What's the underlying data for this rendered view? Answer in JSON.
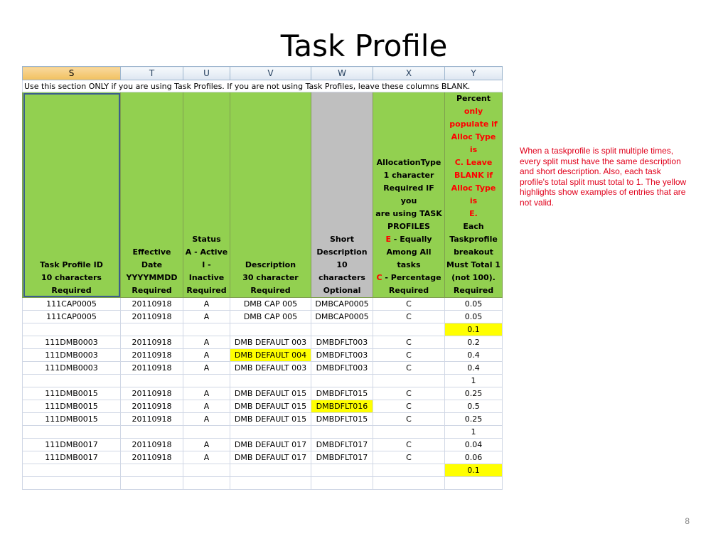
{
  "slide": {
    "title": "Task Profile",
    "page_number": "8",
    "note": "When a taskprofile is split multiple times, every split must have the same description and short description.  Also, each task profile's total split must total to 1.  The yellow highlights show examples of entries that are not valid."
  },
  "sheet": {
    "columns": [
      "S",
      "T",
      "U",
      "V",
      "W",
      "X",
      "Y"
    ],
    "notice": "Use this section ONLY if you are using Task Profiles.  If you are not using Task Profiles, leave these columns BLANK.",
    "headers": {
      "task_profile": [
        "Task Profile ID",
        "10 characters",
        "Required"
      ],
      "effective_date": [
        "Effective Date",
        "YYYYMMDD",
        "Required"
      ],
      "status": [
        "Status",
        "A - Active",
        "I - Inactive",
        "Required"
      ],
      "description": [
        "Description",
        "30 character",
        "Required"
      ],
      "short_description": [
        "Short",
        "Description",
        "10 characters",
        "Optional"
      ],
      "allocation": {
        "lines": [
          "AllocationType",
          "1 character",
          "Required IF you",
          "are using TASK",
          "PROFILES"
        ],
        "e_code": "E",
        "e_text": " - Equally",
        "e_text2": "Among All tasks",
        "c_code": "C",
        "c_text": " - Percentage",
        "required": "Required"
      },
      "percent": {
        "p1": "Percent ",
        "p1_red": "only",
        "red_lines": [
          "populate if",
          "Alloc Type is",
          "C.  Leave",
          "BLANK if",
          "Alloc Type is",
          "E."
        ],
        "black_lines": [
          "Each",
          "Taskprofile",
          "breakout",
          "Must Total 1",
          "(not 100).",
          "Required"
        ]
      }
    },
    "rows": [
      {
        "id": "111CAP0005",
        "date": "20110918",
        "status": "A",
        "desc": "DMB CAP 005",
        "short": "DMBCAP0005",
        "alloc": "C",
        "pct": "0.05"
      },
      {
        "id": "111CAP0005",
        "date": "20110918",
        "status": "A",
        "desc": "DMB CAP 005",
        "short": "DMBCAP0005",
        "alloc": "C",
        "pct": "0.05"
      },
      {
        "id": "",
        "date": "",
        "status": "",
        "desc": "",
        "short": "",
        "alloc": "",
        "pct": "0.1",
        "pct_hl": true
      },
      {
        "id": "111DMB0003",
        "date": "20110918",
        "status": "A",
        "desc": "DMB DEFAULT 003",
        "short": "DMBDFLT003",
        "alloc": "C",
        "pct": "0.2"
      },
      {
        "id": "111DMB0003",
        "date": "20110918",
        "status": "A",
        "desc": "DMB DEFAULT 004",
        "desc_hl": true,
        "short": "DMBDFLT003",
        "alloc": "C",
        "pct": "0.4"
      },
      {
        "id": "111DMB0003",
        "date": "20110918",
        "status": "A",
        "desc": "DMB DEFAULT 003",
        "short": "DMBDFLT003",
        "alloc": "C",
        "pct": "0.4"
      },
      {
        "id": "",
        "date": "",
        "status": "",
        "desc": "",
        "short": "",
        "alloc": "",
        "pct": "1"
      },
      {
        "id": "111DMB0015",
        "date": "20110918",
        "status": "A",
        "desc": "DMB DEFAULT 015",
        "short": "DMBDFLT015",
        "alloc": "C",
        "pct": "0.25"
      },
      {
        "id": "111DMB0015",
        "date": "20110918",
        "status": "A",
        "desc": "DMB DEFAULT 015",
        "short": "DMBDFLT016",
        "short_hl": true,
        "alloc": "C",
        "pct": "0.5"
      },
      {
        "id": "111DMB0015",
        "date": "20110918",
        "status": "A",
        "desc": "DMB DEFAULT 015",
        "short": "DMBDFLT015",
        "alloc": "C",
        "pct": "0.25"
      },
      {
        "id": "",
        "date": "",
        "status": "",
        "desc": "",
        "short": "",
        "alloc": "",
        "pct": "1"
      },
      {
        "id": "111DMB0017",
        "date": "20110918",
        "status": "A",
        "desc": "DMB DEFAULT 017",
        "short": "DMBDFLT017",
        "alloc": "C",
        "pct": "0.04"
      },
      {
        "id": "111DMB0017",
        "date": "20110918",
        "status": "A",
        "desc": "DMB DEFAULT 017",
        "short": "DMBDFLT017",
        "alloc": "C",
        "pct": "0.06"
      },
      {
        "id": "",
        "date": "",
        "status": "",
        "desc": "",
        "short": "",
        "alloc": "",
        "pct": "0.1",
        "pct_hl": true
      },
      {
        "id": "",
        "date": "",
        "status": "",
        "desc": "",
        "short": "",
        "alloc": "",
        "pct": ""
      }
    ]
  }
}
